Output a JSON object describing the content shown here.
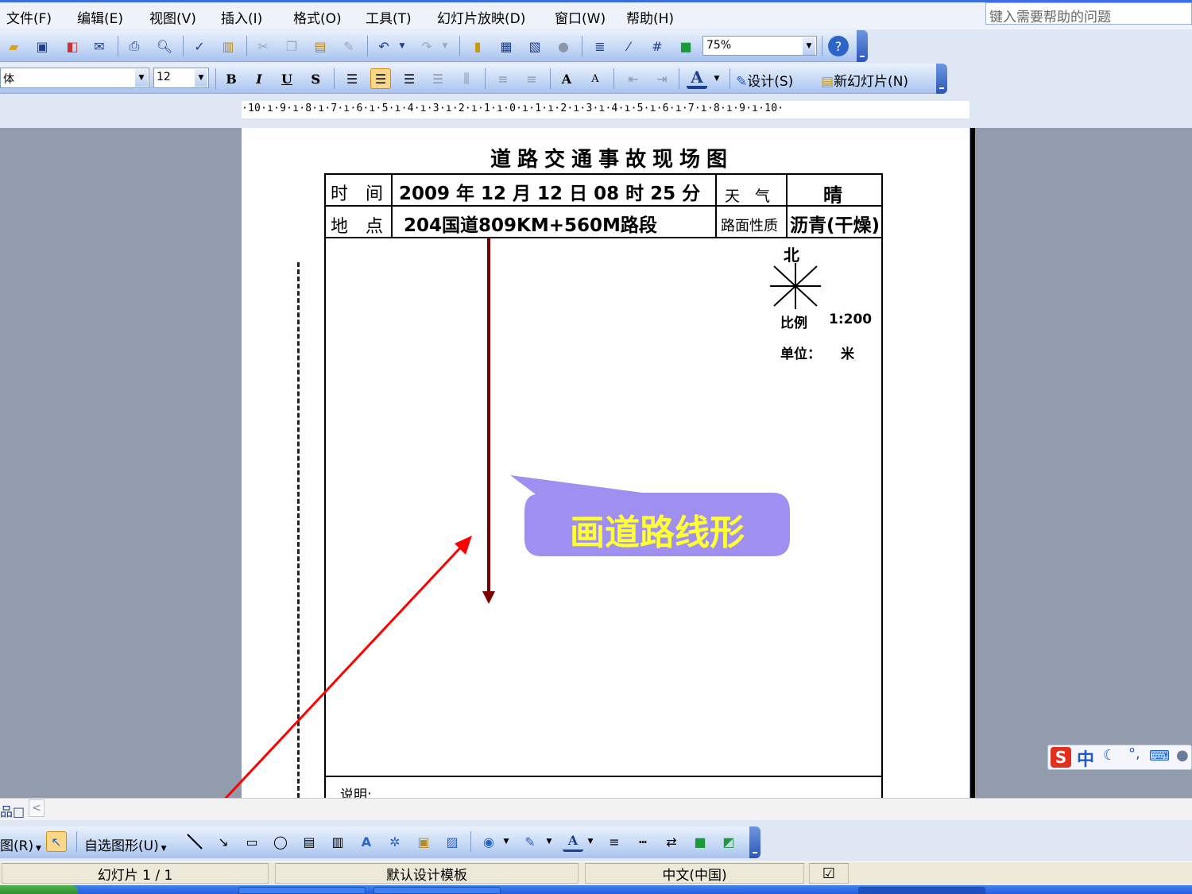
{
  "menu": {
    "items": [
      "文件(F)",
      "编辑(E)",
      "视图(V)",
      "插入(I)",
      "格式(O)",
      "工具(T)",
      "幻灯片放映(D)",
      "窗口(W)",
      "帮助(H)"
    ],
    "help_placeholder": "键入需要帮助的问题"
  },
  "standard_toolbar": {
    "zoom": "75%"
  },
  "format_toolbar": {
    "font_name": "体",
    "font_size": "12",
    "bold": "B",
    "italic": "I",
    "underline": "U",
    "shadow": "S",
    "grow_font": "A",
    "shrink_font": "A",
    "font_color": "A",
    "design_label": "设计(S)",
    "new_slide_label": "新幻灯片(N)"
  },
  "ruler": {
    "text": "·10·ı·9·ı·8·ı·7·ı·6·ı·5·ı·4·ı·3·ı·2·ı·1·ı·0·ı·1·ı·2·ı·3·ı·4·ı·5·ı·6·ı·7·ı·8·ı·9·ı·10·"
  },
  "diagram": {
    "title": "道路交通事故现场图",
    "time_label": "时　间",
    "time_value": "2009 年 12 月 12 日  08 时 25 分",
    "weather_label": "天　气",
    "weather_value": "晴",
    "location_label": "地　点",
    "location_value": "204国道809KM+560M路段",
    "surface_label": "路面性质",
    "surface_value": "沥青(干燥)",
    "north_label": "北",
    "scale_label": "比例",
    "scale_value": "1:200",
    "unit_label": "单位：",
    "unit_value": "米",
    "notes_label": "说明:"
  },
  "callout": {
    "text": "画道路线形",
    "fill": "#9f8ff0",
    "text_color": "#ffff33"
  },
  "drawing_toolbar": {
    "draw_menu": "图(R)",
    "autoshapes_menu": "自选图形(U)",
    "font_color_a": "A"
  },
  "ime": {
    "logo": "S",
    "mode": "中"
  },
  "statusbar": {
    "slide_info": "幻灯片 1 / 1",
    "template": "默认设计模板",
    "language": "中文(中国)"
  },
  "colors": {
    "road_line": "#7a0000",
    "annotation_red": "#ff0000",
    "workspace_bg": "#929cad"
  }
}
